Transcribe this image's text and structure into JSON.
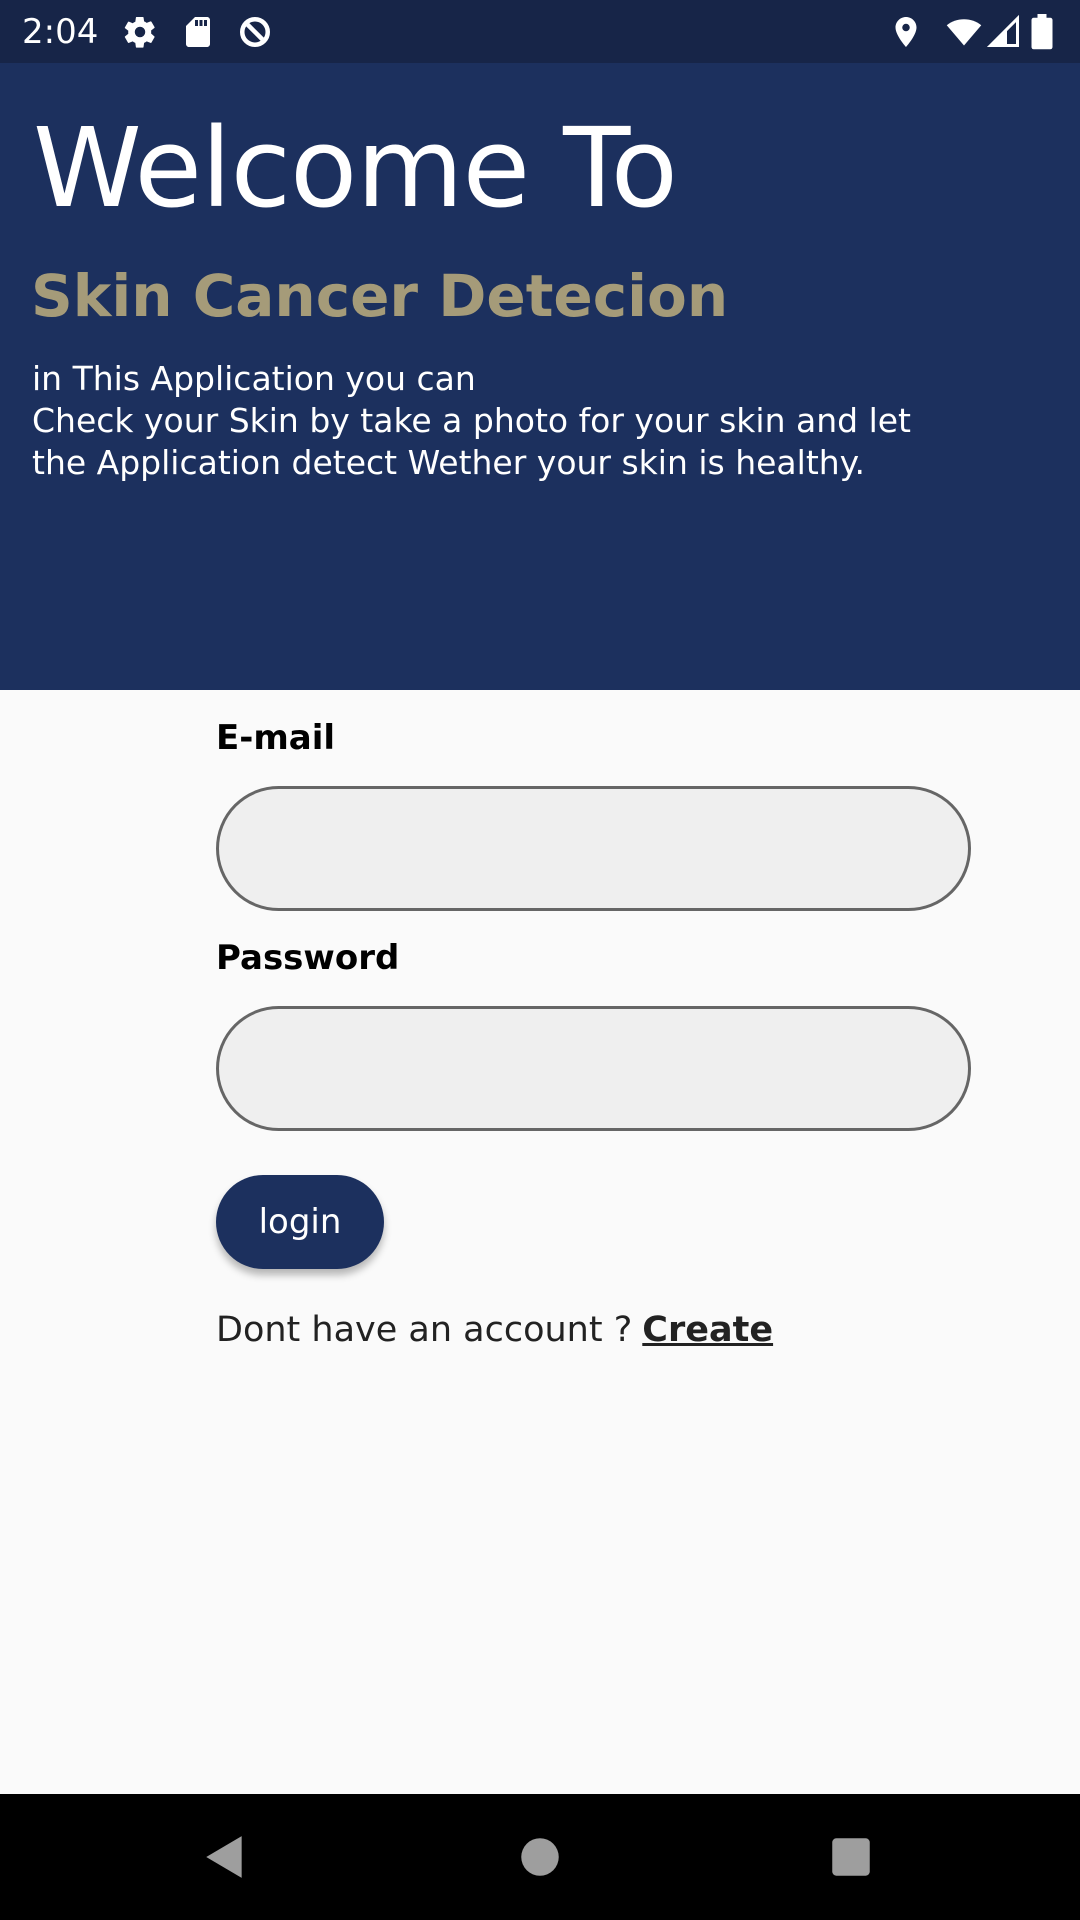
{
  "status_bar": {
    "time": "2:04",
    "icons": [
      "settings-icon",
      "sd-card-icon",
      "data-saver-icon",
      "location-icon",
      "wifi-icon",
      "signal-icon",
      "battery-icon"
    ]
  },
  "hero": {
    "title": "Welcome To",
    "subtitle": "Skin Cancer Detecion",
    "description": "in This Application you can\nCheck your Skin by take a photo for your skin and let\nthe Application detect Wether your skin is healthy.",
    "background_color": "#1c305e",
    "subtitle_color": "#a59b79"
  },
  "form": {
    "email_label": "E-mail",
    "email_value": "",
    "password_label": "Password",
    "password_value": "",
    "login_label": "login",
    "account_prompt": "Dont have an account ?",
    "create_label": "Create"
  },
  "nav_bar": {
    "icons": [
      "back-icon",
      "home-icon",
      "recents-icon"
    ]
  }
}
